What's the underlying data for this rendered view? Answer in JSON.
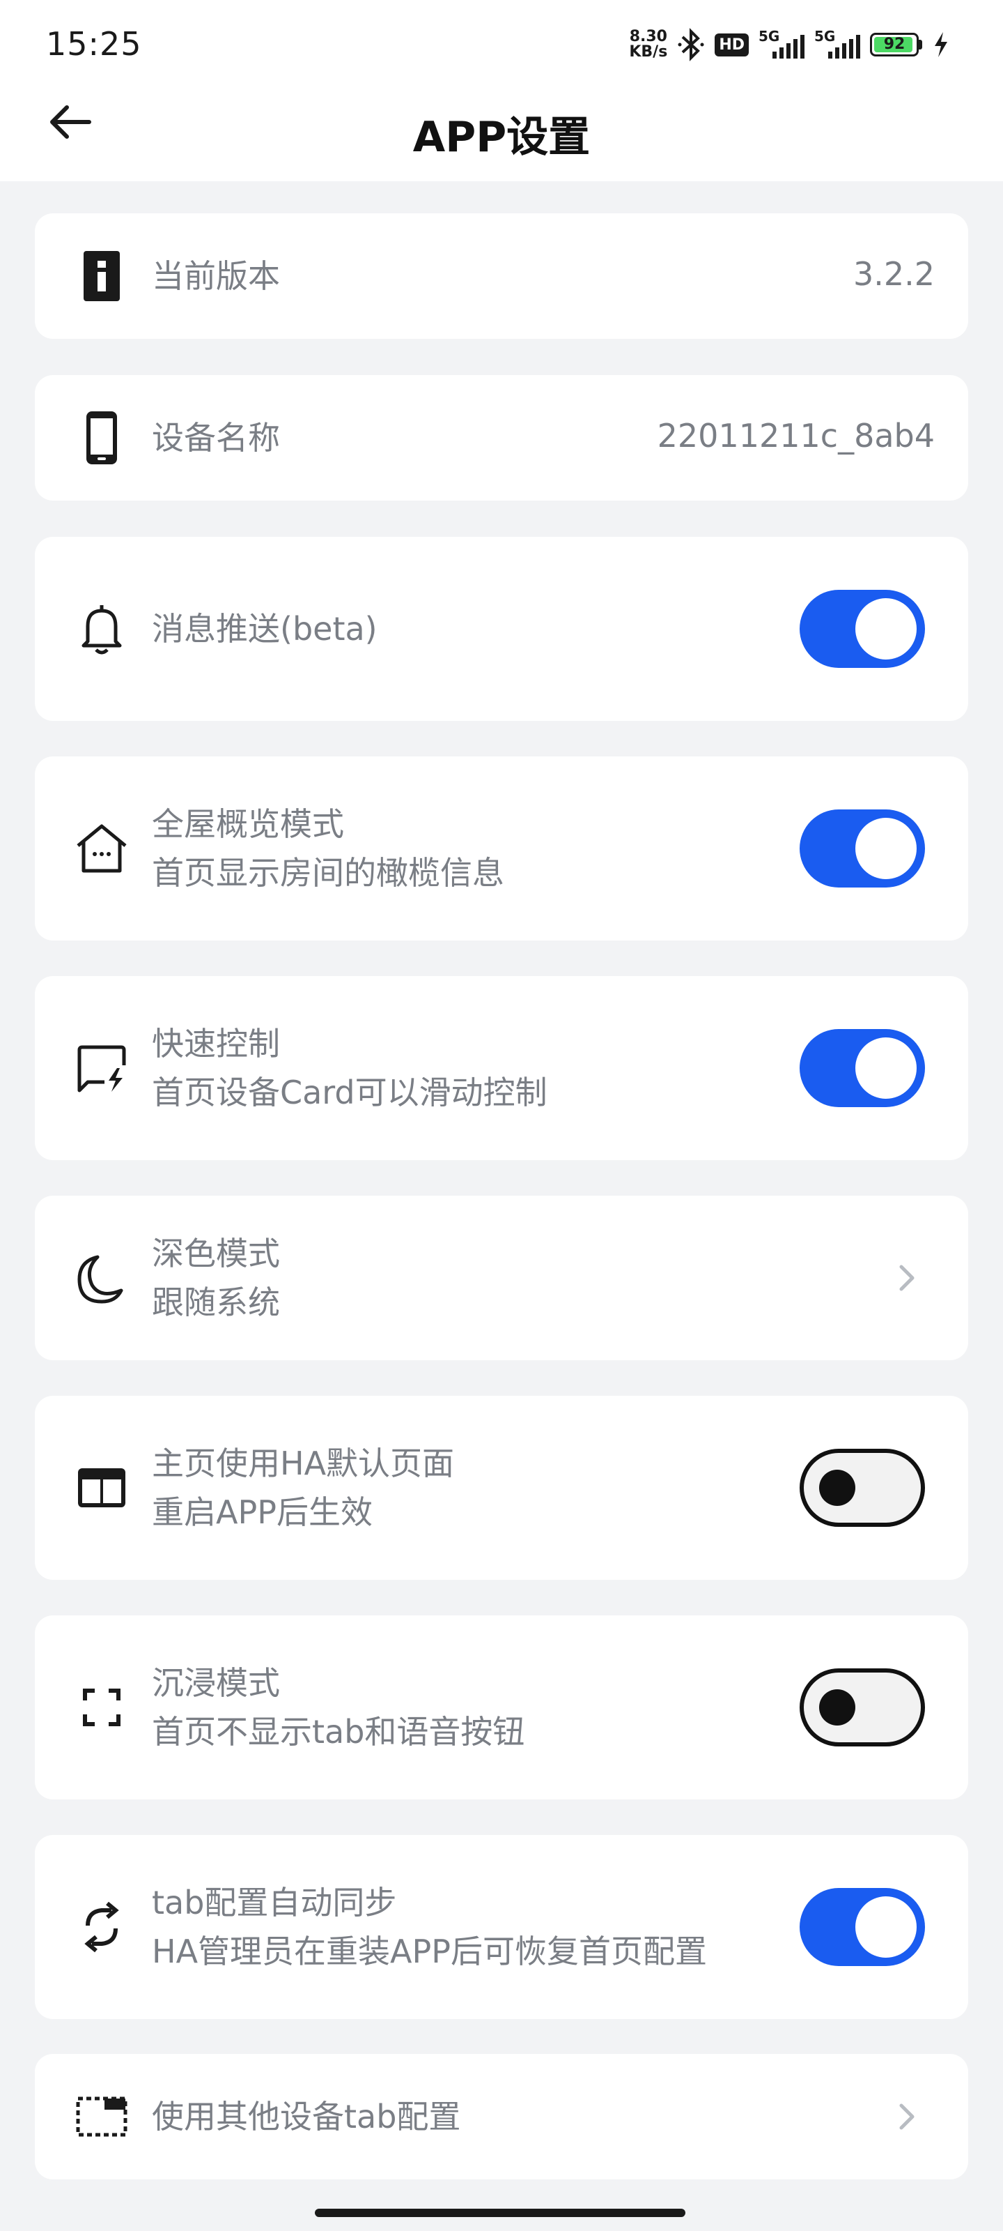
{
  "status_bar": {
    "time": "15:25",
    "net_speed_value": "8.30",
    "net_speed_unit": "KB/s",
    "hd_label": "HD",
    "sim1_label": "5G",
    "sim2_label": "5G",
    "battery_level": "92"
  },
  "header": {
    "title": "APP设置"
  },
  "settings": {
    "version": {
      "label": "当前版本",
      "value": "3.2.2"
    },
    "device_name": {
      "label": "设备名称",
      "value": "22011211c_8ab4"
    },
    "push": {
      "title": "消息推送(beta)",
      "enabled": true
    },
    "overview": {
      "title": "全屋概览模式",
      "subtitle": "首页显示房间的橄榄信息",
      "enabled": true
    },
    "quick_control": {
      "title": "快速控制",
      "subtitle": "首页设备Card可以滑动控制",
      "enabled": true
    },
    "dark_mode": {
      "title": "深色模式",
      "subtitle": "跟随系统"
    },
    "ha_default_page": {
      "title": "主页使用HA默认页面",
      "subtitle": "重启APP后生效",
      "enabled": false
    },
    "immersive": {
      "title": "沉浸模式",
      "subtitle": "首页不显示tab和语音按钮",
      "enabled": false
    },
    "tab_sync": {
      "title": "tab配置自动同步",
      "subtitle": "HA管理员在重装APP后可恢复首页配置",
      "enabled": true
    },
    "other_device_tab": {
      "title": "使用其他设备tab配置"
    }
  },
  "colors": {
    "accent": "#1a5cf0",
    "text_secondary": "#7a7e85",
    "background": "#f2f3f5"
  }
}
